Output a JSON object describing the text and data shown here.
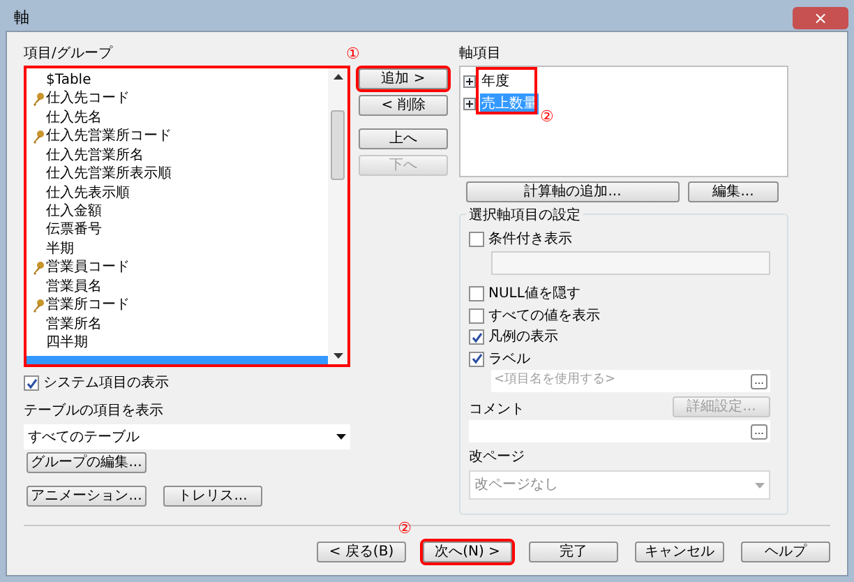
{
  "window": {
    "title": "軸",
    "close": "×"
  },
  "items_panel": {
    "label": "項目/グループ",
    "items": [
      {
        "label": "$Table",
        "key": false
      },
      {
        "label": "仕入先コード",
        "key": true
      },
      {
        "label": "仕入先名",
        "key": false
      },
      {
        "label": "仕入先営業所コード",
        "key": true
      },
      {
        "label": "仕入先営業所名",
        "key": false
      },
      {
        "label": "仕入先営業所表示順",
        "key": false
      },
      {
        "label": "仕入先表示順",
        "key": false
      },
      {
        "label": "仕入金額",
        "key": false
      },
      {
        "label": "伝票番号",
        "key": false
      },
      {
        "label": "半期",
        "key": false
      },
      {
        "label": "営業員コード",
        "key": true
      },
      {
        "label": "営業員名",
        "key": false
      },
      {
        "label": "営業所コード",
        "key": true
      },
      {
        "label": "営業所名",
        "key": false
      },
      {
        "label": "四半期",
        "key": false
      }
    ],
    "system_items": {
      "label": "システム項目の表示",
      "checked": true
    },
    "table_label": "テーブルの項目を表示",
    "table_select": "すべてのテーブル",
    "group_edit": "グループの編集...",
    "animation": "アニメーション...",
    "trellis": "トレリス..."
  },
  "move_buttons": [
    {
      "label": "追加 >",
      "disabled": false,
      "highlighted": true
    },
    {
      "label": "< 削除",
      "disabled": false,
      "highlighted": false
    },
    {
      "label": "上へ",
      "disabled": false,
      "highlighted": false
    },
    {
      "label": "下へ",
      "disabled": true,
      "highlighted": false
    }
  ],
  "annotation_1": "①",
  "axis_panel": {
    "label": "軸項目",
    "items": [
      {
        "label": "年度",
        "selected": false
      },
      {
        "label": "売上数量",
        "selected": true
      }
    ],
    "annotation": "②",
    "add_calc": "計算軸の追加...",
    "edit": "編集..."
  },
  "settings": {
    "title": "選択軸項目の設定",
    "conditional": {
      "label": "条件付き表示",
      "checked": false
    },
    "options": [
      {
        "label": "NULL値を隠す",
        "checked": false
      },
      {
        "label": "すべての値を表示",
        "checked": false
      },
      {
        "label": "凡例の表示",
        "checked": true
      },
      {
        "label": "ラベル",
        "checked": true
      }
    ],
    "label_placeholder": "<項目名を使用する>",
    "ellipsis": "...",
    "detail": "詳細設定...",
    "comment_label": "コメント",
    "comment_ellipsis": "...",
    "page_break_label": "改ページ",
    "page_break": "改ページなし"
  },
  "footer": {
    "annotation": "②",
    "buttons": [
      {
        "label": "< 戻る(B)",
        "highlighted": false
      },
      {
        "label": "次へ(N) >",
        "highlighted": true
      },
      {
        "label": "完了",
        "highlighted": false
      },
      {
        "label": "キャンセル",
        "highlighted": false
      },
      {
        "label": "ヘルプ",
        "highlighted": false
      }
    ]
  }
}
